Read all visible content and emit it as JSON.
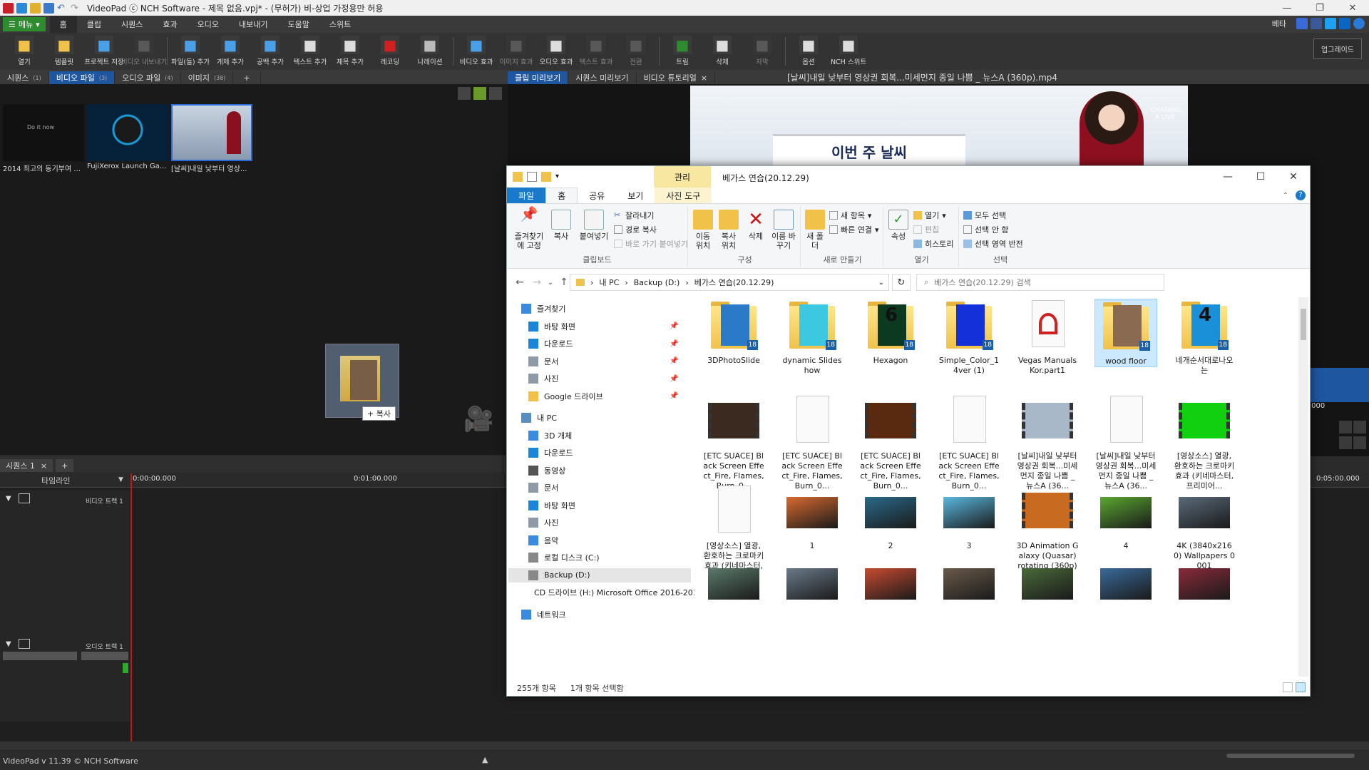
{
  "videopad": {
    "title": "VideoPad ⓒ NCH Software - 제목 없음.vpj* - (무허가) 비-상업 가정용만 허용",
    "menu_button": "메뉴",
    "menu_tabs": [
      "홈",
      "클립",
      "시퀀스",
      "효과",
      "오디오",
      "내보내기",
      "도움말",
      "스위트"
    ],
    "beta_label": "베타",
    "toolbar": [
      {
        "label": "열기",
        "icon": "folder-open-icon",
        "color": "#f0c24a",
        "dim": false
      },
      {
        "label": "템플릿",
        "icon": "template-icon",
        "color": "#f0c24a",
        "dim": false
      },
      {
        "label": "프로젝트 저장",
        "icon": "save-icon",
        "color": "#4aa0e6",
        "dim": false
      },
      {
        "label": "비디오 내보내기",
        "icon": "export-icon",
        "color": "#888",
        "dim": true
      },
      {
        "label": "파일(들) 추가",
        "icon": "add-file-icon",
        "color": "#4aa0e6",
        "dim": false
      },
      {
        "label": "개체 추가",
        "icon": "add-object-icon",
        "color": "#4aa0e6",
        "dim": false
      },
      {
        "label": "공백 추가",
        "icon": "add-blank-icon",
        "color": "#4aa0e6",
        "dim": false
      },
      {
        "label": "텍스트 추가",
        "icon": "add-text-icon",
        "color": "#ddd",
        "dim": false
      },
      {
        "label": "제목 추가",
        "icon": "add-title-icon",
        "color": "#ddd",
        "dim": false
      },
      {
        "label": "레코딩",
        "icon": "record-icon",
        "color": "#d02020",
        "dim": false
      },
      {
        "label": "나레이션",
        "icon": "microphone-icon",
        "color": "#bbb",
        "dim": false
      },
      {
        "label": "비디오 효과",
        "icon": "video-fx-icon",
        "color": "#4aa0e6",
        "dim": false
      },
      {
        "label": "이미지 효과",
        "icon": "image-fx-icon",
        "color": "#888",
        "dim": true
      },
      {
        "label": "오디오 효과",
        "icon": "audio-fx-icon",
        "color": "#ddd",
        "dim": false
      },
      {
        "label": "텍스트 효과",
        "icon": "text-fx-icon",
        "color": "#888",
        "dim": true
      },
      {
        "label": "전환",
        "icon": "transition-icon",
        "color": "#888",
        "dim": true
      },
      {
        "label": "트림",
        "icon": "trim-icon",
        "color": "#2e8b2e",
        "dim": false
      },
      {
        "label": "삭제",
        "icon": "delete-icon",
        "color": "#ddd",
        "dim": false
      },
      {
        "label": "자막",
        "icon": "subtitle-icon",
        "color": "#888",
        "dim": true
      },
      {
        "label": "옵션",
        "icon": "options-icon",
        "color": "#ddd",
        "dim": false
      },
      {
        "label": "NCH 스위트",
        "icon": "suite-icon",
        "color": "#ddd",
        "dim": false
      }
    ],
    "upgrade": "업그레이드",
    "bin_tabs": [
      {
        "label": "시퀀스",
        "n": "(1)"
      },
      {
        "label": "비디오 파일",
        "n": "(3)"
      },
      {
        "label": "오디오 파일",
        "n": "(4)"
      },
      {
        "label": "이미지",
        "n": "(38)"
      }
    ],
    "clips": [
      {
        "caption": "2014 최고의 동기부여 ...",
        "thumb_text": "Do it now"
      },
      {
        "caption": "FujiXerox Launch Ga...",
        "thumb_text": ""
      },
      {
        "caption": "[날씨]내일 낮부터 영상...",
        "thumb_text": ""
      }
    ],
    "drag_copy_label": "+ 복사",
    "preview_tabs": [
      "클립 미리보기",
      "시퀀스 미리보기",
      "비디오 튜토리얼"
    ],
    "preview_file": "[날씨]내일 낮부터 영상권 회복...미세먼지 종일 나쁨 _ 뉴스A (360p).mp4",
    "preview_banner": "이번 주 날씨",
    "preview_logo": "CHANNEL A LIVE",
    "sequence_tab": "시퀀스 1",
    "timeline_label": "타임라인",
    "times": [
      "0:00:00.000",
      "0:01:00.000",
      "0:05:00.000"
    ],
    "video_track": "비디오 트랙 1",
    "audio_track": "오디오 트랙 1",
    "version": "VideoPad v 11.39 © NCH Software",
    "side_time": ".000"
  },
  "explorer": {
    "manage": "관리",
    "title": "베가스 연습(20.12.29)",
    "tabs": [
      "파일",
      "홈",
      "공유",
      "보기",
      "사진 도구"
    ],
    "ribbon": {
      "pin": "즐겨찾기에 고정",
      "copy": "복사",
      "paste": "붙여넣기",
      "cut": "잘라내기",
      "copy_path": "경로 복사",
      "paste_shortcut": "바로 가기 붙여넣기",
      "clipboard": "클립보드",
      "move_to": "이동 위치",
      "copy_to": "복사 위치",
      "delete": "삭제",
      "rename": "이름 바꾸기",
      "organize": "구성",
      "new_folder": "새 폴더",
      "new_item": "새 항목",
      "easy_access": "빠른 연결",
      "new": "새로 만들기",
      "properties": "속성",
      "open": "열기",
      "edit": "편집",
      "history": "히스토리",
      "open_group": "열기",
      "select_all": "모두 선택",
      "select_none": "선택 안 함",
      "invert": "선택 영역 반전",
      "select_group": "선택"
    },
    "address": [
      "내 PC",
      "Backup (D:)",
      "베가스 연습(20.12.29)"
    ],
    "search_placeholder": "베가스 연습(20.12.29) 검색",
    "nav": [
      {
        "label": "즐겨찾기",
        "icon": "star-icon",
        "color": "#3a8be0",
        "pinned": false,
        "indent": 1
      },
      {
        "label": "바탕 화면",
        "icon": "desktop-icon",
        "color": "#1a86d8",
        "pinned": true,
        "indent": 2
      },
      {
        "label": "다운로드",
        "icon": "download-icon",
        "color": "#1a86d8",
        "pinned": true,
        "indent": 2
      },
      {
        "label": "문서",
        "icon": "document-icon",
        "color": "#8e9aa8",
        "pinned": true,
        "indent": 2
      },
      {
        "label": "사진",
        "icon": "pictures-icon",
        "color": "#8e9aa8",
        "pinned": true,
        "indent": 2
      },
      {
        "label": "Google 드라이브",
        "icon": "folder-icon",
        "color": "#f0c24a",
        "pinned": true,
        "indent": 2
      },
      {
        "label": "내 PC",
        "icon": "pc-icon",
        "color": "#5a8ec0",
        "pinned": false,
        "indent": 1
      },
      {
        "label": "3D 개체",
        "icon": "3d-icon",
        "color": "#3a8be0",
        "pinned": false,
        "indent": 2
      },
      {
        "label": "다운로드",
        "icon": "download-icon",
        "color": "#1a86d8",
        "pinned": false,
        "indent": 2
      },
      {
        "label": "동영상",
        "icon": "video-icon",
        "color": "#555",
        "pinned": false,
        "indent": 2
      },
      {
        "label": "문서",
        "icon": "document-icon",
        "color": "#8e9aa8",
        "pinned": false,
        "indent": 2
      },
      {
        "label": "바탕 화면",
        "icon": "desktop-icon",
        "color": "#1a86d8",
        "pinned": false,
        "indent": 2
      },
      {
        "label": "사진",
        "icon": "pictures-icon",
        "color": "#8e9aa8",
        "pinned": false,
        "indent": 2
      },
      {
        "label": "음악",
        "icon": "music-icon",
        "color": "#3a8be0",
        "pinned": false,
        "indent": 2
      },
      {
        "label": "로컬 디스크 (C:)",
        "icon": "drive-icon",
        "color": "#888",
        "pinned": false,
        "indent": 2
      },
      {
        "label": "Backup (D:)",
        "icon": "drive-icon",
        "color": "#888",
        "pinned": false,
        "indent": 2,
        "selected": true
      },
      {
        "label": "CD 드라이브 (H:) Microsoft Office 2016-2019",
        "icon": "cd-icon",
        "color": "#888",
        "pinned": false,
        "indent": 2
      },
      {
        "label": "네트워크",
        "icon": "network-icon",
        "color": "#3a8be0",
        "pinned": false,
        "indent": 1
      }
    ],
    "items": [
      {
        "label": "3DPhotoSlide",
        "kind": "folder",
        "cover": "#2a7ac8",
        "num": "18"
      },
      {
        "label": "dynamic Slideshow",
        "kind": "folder",
        "cover": "#3cc8e0",
        "num": "18"
      },
      {
        "label": "Hexagon",
        "kind": "folder",
        "cover": "#0c3a20",
        "num": "18",
        "cover_text": "6"
      },
      {
        "label": "Simple_Color_14ver (1)",
        "kind": "folder",
        "cover": "#1430d8",
        "num": "18"
      },
      {
        "label": "Vegas Manuals Kor.part1",
        "kind": "pdf",
        "cover": "#d02020",
        "num": ""
      },
      {
        "label": "wood floor",
        "kind": "folder",
        "cover": "#8a6a50",
        "num": "18",
        "selected": true
      },
      {
        "label": "네개순서대로나오는",
        "kind": "folder",
        "cover": "#1a90d8",
        "num": "18",
        "cover_text": "4"
      },
      {
        "label": "[ETC SUACE] Black Screen Effect_Fire, Flames, Burn_0...",
        "kind": "film",
        "cover": "#3a2a20"
      },
      {
        "label": "[ETC SUACE] Black Screen Effect_Fire, Flames, Burn_0...",
        "kind": "doc"
      },
      {
        "label": "[ETC SUACE] Black Screen Effect_Fire, Flames, Burn_0...",
        "kind": "film",
        "cover": "#5a2a10"
      },
      {
        "label": "[ETC SUACE] Black Screen Effect_Fire, Flames, Burn_0...",
        "kind": "doc"
      },
      {
        "label": "[날씨]내일 낮부터 영상권 회복...미세먼지 종일 나쁨 _ 뉴스A (36...",
        "kind": "film",
        "cover": "#a8b8c8"
      },
      {
        "label": "[날씨]내일 낮부터 영상권 회복...미세먼지 종일 나쁨 _ 뉴스A (36...",
        "kind": "doc"
      },
      {
        "label": "[영상소스] 열광, 환호하는 크로마키 효과 (키네마스터, 프리미어...",
        "kind": "film",
        "cover": "#10d010"
      },
      {
        "label": "[영상소스] 열광, 환호하는 크로마키 효과 (키네마스터, 프리미어...",
        "kind": "doc"
      },
      {
        "label": "1",
        "kind": "image",
        "cover": "#d86a30"
      },
      {
        "label": "2",
        "kind": "image",
        "cover": "#2a6a8a"
      },
      {
        "label": "3",
        "kind": "image",
        "cover": "#5ab8e0"
      },
      {
        "label": "3D Animation Galaxy (Quasar) rotating (360p)",
        "kind": "film",
        "cover": "#c86a20"
      },
      {
        "label": "4",
        "kind": "image",
        "cover": "#5aa830"
      },
      {
        "label": "4K (3840x2160) Wallpapers 0001",
        "kind": "image",
        "cover": "#5a6a7a"
      },
      {
        "label": "",
        "kind": "image",
        "cover": "#5a7a6a"
      },
      {
        "label": "",
        "kind": "image",
        "cover": "#6a7a8a"
      },
      {
        "label": "",
        "kind": "image",
        "cover": "#c84a30"
      },
      {
        "label": "",
        "kind": "image",
        "cover": "#6a5a4a"
      },
      {
        "label": "",
        "kind": "image",
        "cover": "#4a6a3a"
      },
      {
        "label": "",
        "kind": "image",
        "cover": "#3a6a9a"
      },
      {
        "label": "",
        "kind": "image",
        "cover": "#8a2a3a"
      }
    ],
    "status_count": "255개 항목",
    "status_selected": "1개 항목 선택함"
  }
}
